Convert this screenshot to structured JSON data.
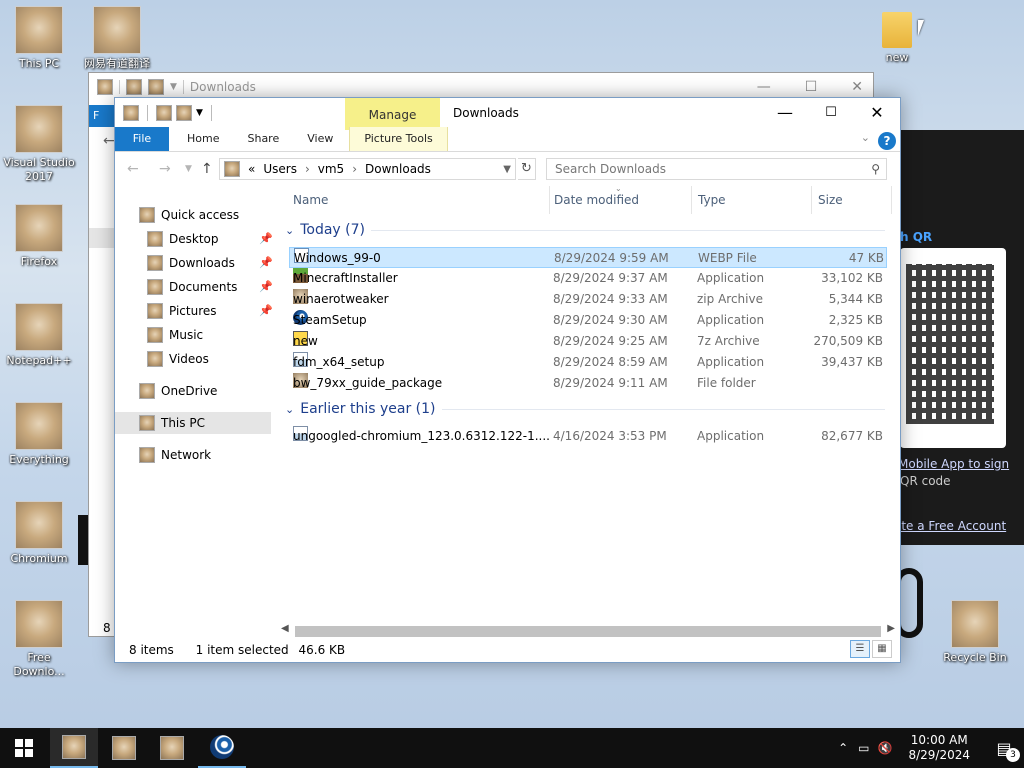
{
  "desktop": {
    "icons": [
      {
        "label": "This PC"
      },
      {
        "label": "网易有道翻译"
      },
      {
        "label": "Visual Studio 2017"
      },
      {
        "label": "Firefox"
      },
      {
        "label": "Notepad++"
      },
      {
        "label": "Everything"
      },
      {
        "label": "Chromium"
      },
      {
        "label": "Free Downlo..."
      },
      {
        "label": "new"
      },
      {
        "label": "Recycle Bin"
      }
    ]
  },
  "bg_app": {
    "qr_label": "h QR",
    "link_mobile": "Mobile App to sign",
    "qr_text": "QR code",
    "link_account": "ate a Free Account"
  },
  "back_window": {
    "title": "Downloads",
    "status_partial": "8 i",
    "file_tab_partial": "F"
  },
  "window": {
    "title": "Downloads",
    "manage_tab": "Manage",
    "ribbon_tabs": [
      "File",
      "Home",
      "Share",
      "View",
      "Picture Tools"
    ],
    "help": "?",
    "address": {
      "crumbs": [
        "«",
        "Users",
        "vm5",
        "Downloads"
      ]
    },
    "search_placeholder": "Search Downloads",
    "nav": {
      "quick_access": "Quick access",
      "desktop": "Desktop",
      "downloads": "Downloads",
      "documents": "Documents",
      "pictures": "Pictures",
      "music": "Music",
      "videos": "Videos",
      "onedrive": "OneDrive",
      "this_pc": "This PC",
      "network": "Network"
    },
    "columns": {
      "name": "Name",
      "date": "Date modified",
      "type": "Type",
      "size": "Size"
    },
    "groups": {
      "today": "Today (7)",
      "earlier": "Earlier this year (1)"
    },
    "files_today": [
      {
        "name": "Windows_99-0",
        "date": "8/29/2024 9:59 AM",
        "type": "WEBP File",
        "size": "47 KB",
        "icon": "webp-file-icon"
      },
      {
        "name": "MinecraftInstaller",
        "date": "8/29/2024 9:37 AM",
        "type": "Application",
        "size": "33,102 KB",
        "icon": "minecraft-icon"
      },
      {
        "name": "winaerotweaker",
        "date": "8/29/2024 9:33 AM",
        "type": "zip Archive",
        "size": "5,344 KB",
        "icon": "archive-icon"
      },
      {
        "name": "SteamSetup",
        "date": "8/29/2024 9:30 AM",
        "type": "Application",
        "size": "2,325 KB",
        "icon": "steam-icon"
      },
      {
        "name": "new",
        "date": "8/29/2024 9:25 AM",
        "type": "7z Archive",
        "size": "270,509 KB",
        "icon": "7z-icon"
      },
      {
        "name": "fdm_x64_setup",
        "date": "8/29/2024 8:59 AM",
        "type": "Application",
        "size": "39,437 KB",
        "icon": "installer-icon"
      },
      {
        "name": "bw_79xx_guide_package",
        "date": "8/29/2024 9:11 AM",
        "type": "File folder",
        "size": "",
        "icon": "folder-icon"
      }
    ],
    "files_earlier": [
      {
        "name": "ungoogled-chromium_123.0.6312.122-1....",
        "date": "4/16/2024 3:53 PM",
        "type": "Application",
        "size": "82,677 KB",
        "icon": "installer-icon"
      }
    ],
    "status": {
      "items": "8 items",
      "selected": "1 item selected",
      "size": "46.6 KB"
    }
  },
  "taskbar": {
    "time": "10:00 AM",
    "date": "8/29/2024",
    "notifications": "3"
  }
}
